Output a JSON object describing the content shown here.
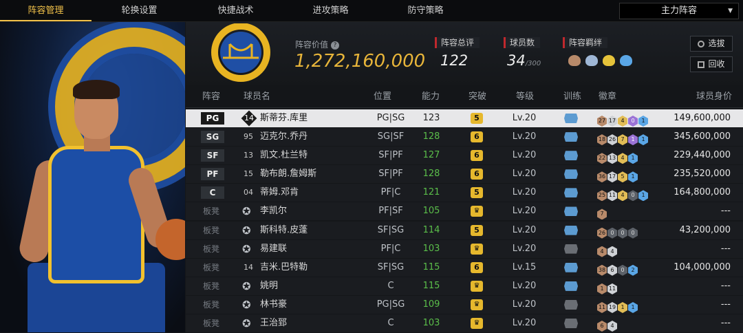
{
  "nav": {
    "tabs": [
      "阵容管理",
      "轮换设置",
      "快捷战术",
      "进攻策略",
      "防守策略"
    ],
    "active_tab": 0,
    "lineup_select": "主力阵容"
  },
  "header": {
    "value_label": "阵容价值",
    "value": "1,272,160,000",
    "overall_label": "阵容总评",
    "overall": "122",
    "players_label": "球员数",
    "players_count": "34",
    "players_max": "/300",
    "bond_label": "阵容羁绊",
    "bond_icons": [
      "bond-icon-1",
      "bond-icon-2",
      "bond-icon-3",
      "bond-icon-4"
    ],
    "btn_pick": "选拔",
    "btn_recycle": "回收"
  },
  "columns": [
    "阵容",
    "球员名",
    "位置",
    "能力",
    "突破",
    "等级",
    "训练",
    "徽章",
    "球员身价"
  ],
  "rows": [
    {
      "slot": "PG",
      "num": "14",
      "diamond": true,
      "name": "斯蒂芬.库里",
      "pos": "PG|SG",
      "ability": "123",
      "break": "5",
      "crown": false,
      "level": "Lv.20",
      "train": true,
      "badges": [
        [
          "br",
          "27"
        ],
        [
          "sv",
          "17"
        ],
        [
          "gd",
          "4"
        ],
        [
          "pu",
          "0"
        ],
        [
          "bl",
          "1"
        ]
      ],
      "worth": "149,600,000",
      "selected": true
    },
    {
      "slot": "SG",
      "num": "95",
      "diamond": false,
      "name": "迈克尔.乔丹",
      "pos": "SG|SF",
      "ability": "128",
      "break": "6",
      "crown": false,
      "level": "Lv.20",
      "train": true,
      "badges": [
        [
          "br",
          "18"
        ],
        [
          "sv",
          "26"
        ],
        [
          "gd",
          "7"
        ],
        [
          "pu",
          "1"
        ],
        [
          "bl",
          "1"
        ]
      ],
      "worth": "345,600,000"
    },
    {
      "slot": "SF",
      "num": "13",
      "diamond": false,
      "name": "凯文.杜兰特",
      "pos": "SF|PF",
      "ability": "127",
      "break": "6",
      "crown": false,
      "level": "Lv.20",
      "train": true,
      "badges": [
        [
          "br",
          "22"
        ],
        [
          "sv",
          "13"
        ],
        [
          "gd",
          "4"
        ],
        [
          "bl",
          "1"
        ]
      ],
      "worth": "229,440,000"
    },
    {
      "slot": "PF",
      "num": "15",
      "diamond": false,
      "name": "勒布朗.詹姆斯",
      "pos": "SF|PF",
      "ability": "128",
      "break": "6",
      "crown": false,
      "level": "Lv.20",
      "train": true,
      "badges": [
        [
          "br",
          "36"
        ],
        [
          "sv",
          "17"
        ],
        [
          "gd",
          "5"
        ],
        [
          "bl",
          "1"
        ]
      ],
      "worth": "235,520,000"
    },
    {
      "slot": "C",
      "num": "04",
      "diamond": false,
      "name": "蒂姆.邓肯",
      "pos": "PF|C",
      "ability": "121",
      "break": "5",
      "crown": false,
      "level": "Lv.20",
      "train": true,
      "badges": [
        [
          "br",
          "25"
        ],
        [
          "sv",
          "11"
        ],
        [
          "gd",
          "4"
        ],
        [
          "dk",
          "0"
        ],
        [
          "bl",
          "1"
        ]
      ],
      "worth": "164,800,000"
    },
    {
      "slot": "板凳",
      "num": "",
      "star": true,
      "name": "李凯尔",
      "pos": "PF|SF",
      "ability": "105",
      "break": "",
      "crown": true,
      "level": "Lv.20",
      "train": true,
      "badges": [
        [
          "br",
          "7"
        ]
      ],
      "worth": "---"
    },
    {
      "slot": "板凳",
      "num": "",
      "star": true,
      "name": "斯科特.皮蓬",
      "pos": "SF|SG",
      "ability": "114",
      "break": "5",
      "crown": false,
      "level": "Lv.20",
      "train": true,
      "badges": [
        [
          "br",
          "26"
        ],
        [
          "dk",
          "0"
        ],
        [
          "dk",
          "0"
        ],
        [
          "dk",
          "0"
        ]
      ],
      "worth": "43,200,000"
    },
    {
      "slot": "板凳",
      "num": "",
      "star": true,
      "name": "易建联",
      "pos": "PF|C",
      "ability": "103",
      "break": "",
      "crown": true,
      "level": "Lv.20",
      "train": false,
      "badges": [
        [
          "br",
          "4"
        ],
        [
          "sv",
          "4"
        ]
      ],
      "worth": "---"
    },
    {
      "slot": "板凳",
      "num": "14",
      "diamond": false,
      "name": "吉米.巴特勒",
      "pos": "SF|SG",
      "ability": "115",
      "break": "6",
      "crown": false,
      "level": "Lv.15",
      "train": true,
      "badges": [
        [
          "br",
          "38"
        ],
        [
          "sv",
          "6"
        ],
        [
          "dk",
          "0"
        ],
        [
          "bl",
          "2"
        ]
      ],
      "worth": "104,000,000"
    },
    {
      "slot": "板凳",
      "num": "",
      "star": true,
      "name": "姚明",
      "pos": "C",
      "ability": "115",
      "break": "",
      "crown": true,
      "level": "Lv.20",
      "train": true,
      "badges": [
        [
          "br",
          "1"
        ],
        [
          "sv",
          "11"
        ]
      ],
      "worth": "---"
    },
    {
      "slot": "板凳",
      "num": "",
      "star": true,
      "name": "林书豪",
      "pos": "PG|SG",
      "ability": "109",
      "break": "",
      "crown": true,
      "level": "Lv.20",
      "train": false,
      "badges": [
        [
          "br",
          "11"
        ],
        [
          "sv",
          "19"
        ],
        [
          "gd",
          "1"
        ],
        [
          "bl",
          "1"
        ]
      ],
      "worth": "---"
    },
    {
      "slot": "板凳",
      "num": "",
      "star": true,
      "name": "王治郅",
      "pos": "C",
      "ability": "103",
      "break": "",
      "crown": true,
      "level": "Lv.20",
      "train": false,
      "badges": [
        [
          "br",
          "6"
        ],
        [
          "sv",
          "4"
        ]
      ],
      "worth": "---"
    }
  ],
  "colors": {
    "accent": "#f2c24a",
    "value": "#e8b53a",
    "ability": "#5bbf4a",
    "red_marker": "#c0282d"
  }
}
